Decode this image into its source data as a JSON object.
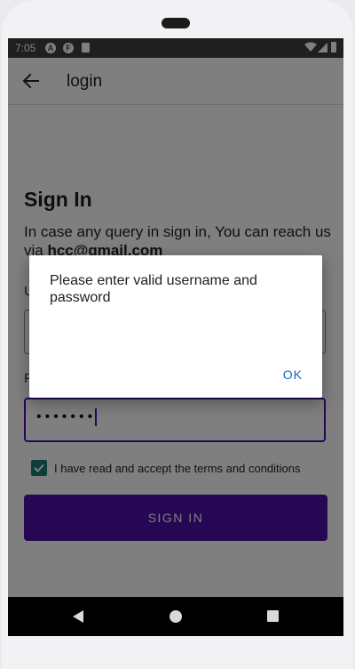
{
  "status_bar": {
    "time": "7:05",
    "icons": [
      "a-badge-icon",
      "f-badge-icon",
      "sd-card-icon",
      "wifi-icon",
      "signal-icon",
      "battery-icon"
    ],
    "badge_a": "A",
    "badge_f": "F"
  },
  "app_bar": {
    "title": "login",
    "back_icon": "arrow-left-icon"
  },
  "form": {
    "heading": "Sign In",
    "description_prefix": "In case any query in sign in, You can reach us via ",
    "email": "hcc@gmail.com",
    "username_label": "U",
    "username_value": "",
    "password_label": "P",
    "password_value": "•••••••",
    "terms_checked": true,
    "terms_label": "I have read and accept the terms and conditions",
    "signin_label": "SIGN IN"
  },
  "dialog": {
    "message": "Please enter valid username and password",
    "ok_label": "OK"
  },
  "nav_bar": {
    "icons": [
      "back-triangle-icon",
      "home-circle-icon",
      "recents-square-icon"
    ]
  },
  "colors": {
    "accent": "#4b0fa6",
    "checkbox": "#1e7a6e",
    "dialog_button": "#1565c0",
    "status_bar": "#3f3f3f"
  }
}
